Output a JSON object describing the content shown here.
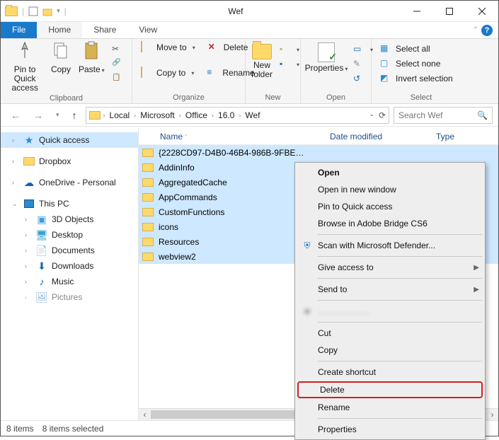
{
  "window": {
    "title": "Wef"
  },
  "ribbon_tabs": {
    "file": "File",
    "home": "Home",
    "share": "Share",
    "view": "View"
  },
  "ribbon": {
    "clipboard": {
      "label": "Clipboard",
      "pin": "Pin to Quick\naccess",
      "copy": "Copy",
      "paste": "Paste"
    },
    "organize": {
      "label": "Organize",
      "move_to": "Move to",
      "copy_to": "Copy to",
      "delete": "Delete",
      "rename": "Rename"
    },
    "new": {
      "label": "New",
      "new_folder": "New\nfolder"
    },
    "open": {
      "label": "Open",
      "properties": "Properties"
    },
    "select": {
      "label": "Select",
      "select_all": "Select all",
      "select_none": "Select none",
      "invert": "Invert selection"
    }
  },
  "breadcrumb": [
    "Local",
    "Microsoft",
    "Office",
    "16.0",
    "Wef"
  ],
  "search_placeholder": "Search Wef",
  "columns": {
    "name": "Name",
    "date": "Date modified",
    "type": "Type"
  },
  "sidebar": {
    "quick_access": "Quick access",
    "dropbox": "Dropbox",
    "onedrive": "OneDrive - Personal",
    "this_pc": "This PC",
    "children": [
      "3D Objects",
      "Desktop",
      "Documents",
      "Downloads",
      "Music",
      "Pictures"
    ]
  },
  "rows": [
    "{2228CD97-D4B0-46B4-986B-9FBE…",
    "AddinInfo",
    "AggregatedCache",
    "AppCommands",
    "CustomFunctions",
    "icons",
    "Resources",
    "webview2"
  ],
  "status": {
    "items": "8 items",
    "selected": "8 items selected"
  },
  "context_menu": {
    "open": "Open",
    "open_new": "Open in new window",
    "pin": "Pin to Quick access",
    "bridge": "Browse in Adobe Bridge CS6",
    "defender": "Scan with Microsoft Defender...",
    "give_access": "Give access to",
    "send_to": "Send to",
    "blurred": "………………",
    "cut": "Cut",
    "copy": "Copy",
    "shortcut": "Create shortcut",
    "delete": "Delete",
    "rename": "Rename",
    "properties": "Properties"
  }
}
